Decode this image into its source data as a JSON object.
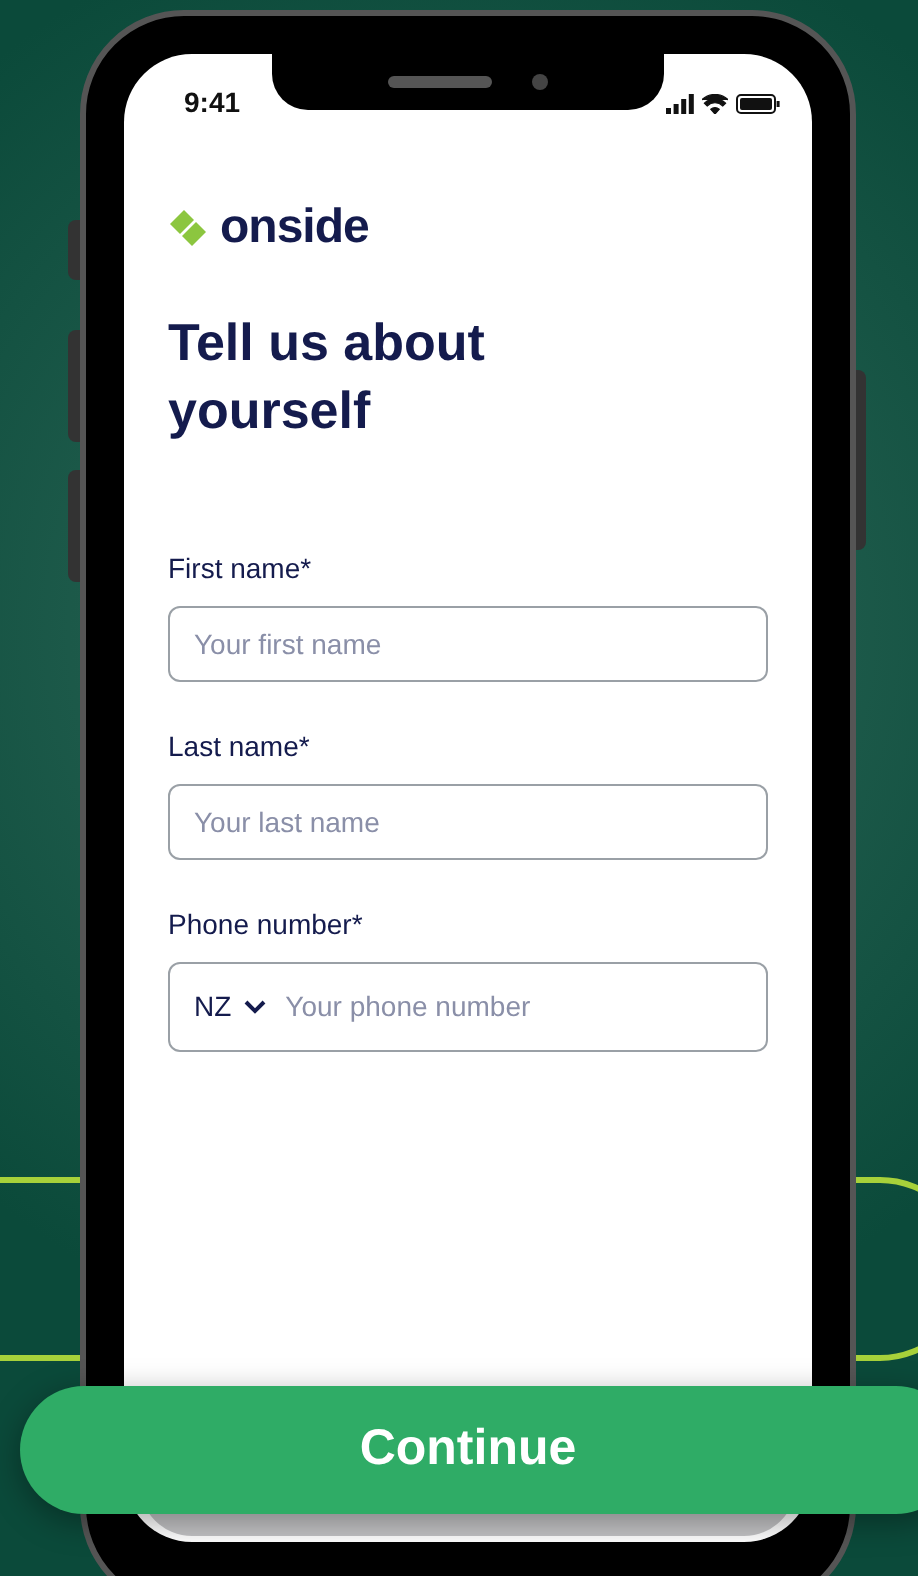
{
  "status_bar": {
    "time": "9:41"
  },
  "brand": {
    "name": "onside"
  },
  "heading": "Tell us about yourself",
  "fields": [
    {
      "kind": "text",
      "label": "First name*",
      "placeholder": "Your first name"
    },
    {
      "kind": "text",
      "label": "Last name*",
      "placeholder": "Your last name"
    },
    {
      "kind": "phone",
      "label": "Phone number*",
      "country_code": "NZ",
      "placeholder": "Your phone number"
    }
  ],
  "continue_button": {
    "label": "Continue"
  }
}
